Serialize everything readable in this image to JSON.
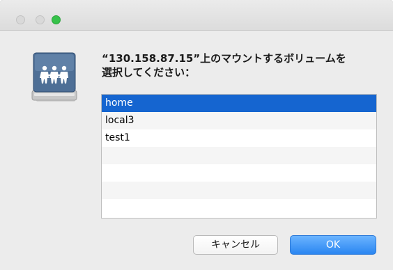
{
  "window": {
    "traffic_lights": [
      "close",
      "minimize",
      "zoom"
    ],
    "colors": {
      "zoom": "#36c24a",
      "selection": "#1565d0",
      "primary_button": "#2a86f1"
    }
  },
  "dialog": {
    "icon": "server-share-icon",
    "prompt_line1": "“130.158.87.15”上のマウントするボリュームを",
    "prompt_line2": "選択してください：",
    "volumes": [
      {
        "name": "home",
        "selected": true
      },
      {
        "name": "local3",
        "selected": false
      },
      {
        "name": "test1",
        "selected": false
      }
    ],
    "cancel_label": "キャンセル",
    "ok_label": "OK"
  }
}
